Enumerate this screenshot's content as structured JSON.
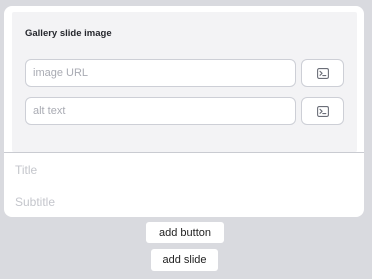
{
  "panel": {
    "title": "Gallery slide image",
    "image_url": {
      "value": "",
      "placeholder": "image URL",
      "button_icon": "terminal-icon"
    },
    "alt_text": {
      "value": "",
      "placeholder": "alt text",
      "button_icon": "terminal-icon"
    }
  },
  "slide": {
    "title_placeholder": "Title",
    "subtitle_placeholder": "Subtitle"
  },
  "actions": {
    "add_button_label": "add button",
    "add_slide_label": "add slide"
  },
  "colors": {
    "background": "#d9dadf",
    "card": "#ffffff",
    "panel": "#f3f3f5",
    "field_border": "#cdcfd6",
    "placeholder": "#a9abb3",
    "icon": "#6b6e78"
  }
}
